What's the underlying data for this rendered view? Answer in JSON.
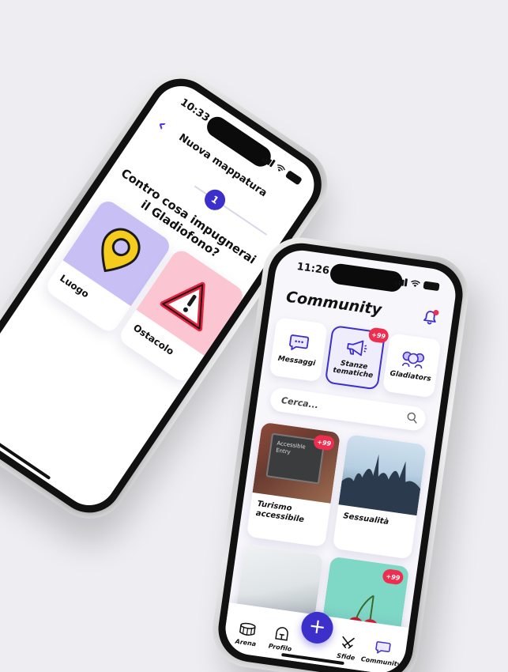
{
  "phone1": {
    "status": {
      "time": "10:33"
    },
    "header": {
      "title": "Nuova mappatura"
    },
    "stepper": {
      "current_step": "1"
    },
    "question": "Contro cosa impugnerai il Gladiofono?",
    "options": [
      {
        "label": "Luogo",
        "icon": "map-pin-icon"
      },
      {
        "label": "Ostacolo",
        "icon": "warning-triangle-icon"
      }
    ]
  },
  "phone2": {
    "status": {
      "time": "11:26"
    },
    "header": {
      "title": "Community"
    },
    "categories": [
      {
        "label": "Messaggi",
        "icon": "chat-bubble-icon",
        "badge": ""
      },
      {
        "label": "Stanze tematiche",
        "icon": "megaphone-icon",
        "badge": "+99"
      },
      {
        "label": "Gladiators",
        "icon": "group-icon",
        "badge": ""
      }
    ],
    "search": {
      "placeholder": "Cerca..."
    },
    "rooms": [
      {
        "label": "Turismo accessibile",
        "badge": "+99",
        "sign_line1": "Accessible",
        "sign_line2": "Entry"
      },
      {
        "label": "Sessualità",
        "badge": ""
      },
      {
        "label": "",
        "badge": ""
      },
      {
        "label": "",
        "badge": "+99"
      }
    ],
    "tabbar": {
      "items": [
        {
          "label": "Arena"
        },
        {
          "label": "Profilo"
        },
        {
          "label": "Sfide"
        },
        {
          "label": "Community"
        }
      ],
      "fab_label": "+"
    }
  },
  "colors": {
    "accent": "#3d2fc9",
    "badge": "#ef2d4f",
    "place_card_bg": "#c8bff5",
    "obstacle_card_bg": "#fbc6d2",
    "background": "#eeeef2"
  }
}
